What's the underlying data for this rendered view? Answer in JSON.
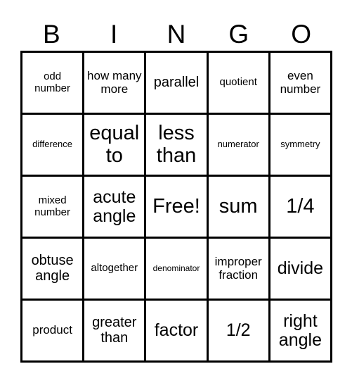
{
  "card": {
    "title": "BINGO",
    "background_color": "#ffffff",
    "border_color": "#000000",
    "text_color": "#000000"
  },
  "header": {
    "letters": [
      {
        "label": "B"
      },
      {
        "label": "I"
      },
      {
        "label": "N"
      },
      {
        "label": "G"
      },
      {
        "label": "O"
      }
    ]
  },
  "grid": {
    "columns": 5,
    "rows": 5,
    "free_space": "Free!",
    "cells": [
      [
        {
          "text": "odd number",
          "size": "md"
        },
        {
          "text": "how many more",
          "size": "lg"
        },
        {
          "text": "parallel",
          "size": "xl"
        },
        {
          "text": "quotient",
          "size": "md"
        },
        {
          "text": "even number",
          "size": "lg"
        }
      ],
      [
        {
          "text": "difference",
          "size": "sm"
        },
        {
          "text": "equal to",
          "size": "3xl"
        },
        {
          "text": "less than",
          "size": "3xl"
        },
        {
          "text": "numerator",
          "size": "sm"
        },
        {
          "text": "symmetry",
          "size": "sm"
        }
      ],
      [
        {
          "text": "mixed number",
          "size": "md"
        },
        {
          "text": "acute angle",
          "size": "2xl"
        },
        {
          "text": "Free!",
          "size": "3xl"
        },
        {
          "text": "sum",
          "size": "3xl"
        },
        {
          "text": "1/4",
          "size": "3xl"
        }
      ],
      [
        {
          "text": "obtuse angle",
          "size": "xl"
        },
        {
          "text": "altogether",
          "size": "md"
        },
        {
          "text": "denominator",
          "size": "xs"
        },
        {
          "text": "improper fraction",
          "size": "lg"
        },
        {
          "text": "divide",
          "size": "2xl"
        }
      ],
      [
        {
          "text": "product",
          "size": "lg"
        },
        {
          "text": "greater than",
          "size": "xl"
        },
        {
          "text": "factor",
          "size": "2xl"
        },
        {
          "text": "1/2",
          "size": "2xl"
        },
        {
          "text": "right angle",
          "size": "2xl"
        }
      ]
    ]
  }
}
